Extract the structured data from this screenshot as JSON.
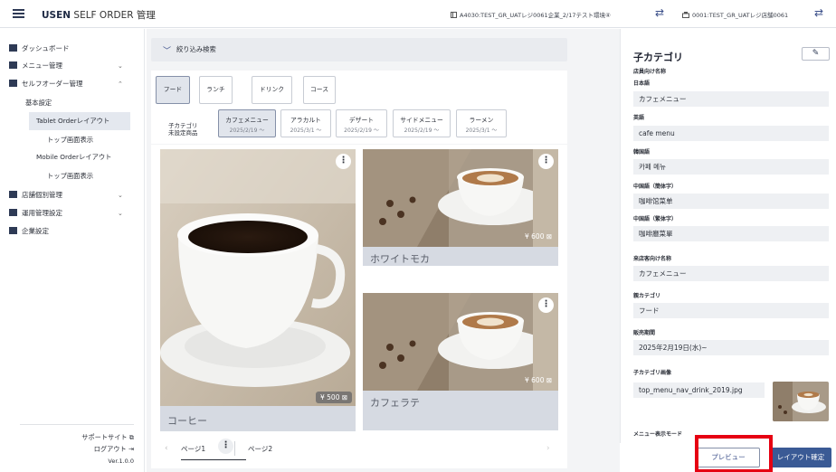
{
  "header": {
    "menu_icon": "hamburger-icon",
    "app_brand": "USEN",
    "app_title": "SELF ORDER 管理",
    "store_info": "A4030:TEST_GR_UATレジ0061企業_2/17テスト環境④",
    "register_info": "0001:TEST_GR_UATレジ店舗0061",
    "swap_icon": "swap-arrows-icon"
  },
  "sidebar": {
    "items": [
      {
        "label": "ダッシュボード",
        "icon": "dashboard-icon"
      },
      {
        "label": "メニュー管理",
        "icon": "book-icon",
        "chevron": "⌄"
      },
      {
        "label": "セルフオーダー管理",
        "icon": "tablet-icon",
        "chevron": "⌃"
      },
      {
        "label": "店舗個別管理",
        "icon": "store-icon",
        "chevron": "⌄"
      },
      {
        "label": "運用管理設定",
        "icon": "folder-icon",
        "chevron": "⌄"
      },
      {
        "label": "企業設定",
        "icon": "building-icon"
      }
    ],
    "subitems": [
      "基本設定",
      "Tablet Orderレイアウト",
      "トップ画面表示",
      "Mobile Orderレイアウト",
      "トップ画面表示"
    ],
    "footer": {
      "support": "サポートサイト",
      "logout": "ログアウト",
      "version": "Ver.1.0.0"
    }
  },
  "main": {
    "filter_label": "絞り込み検索",
    "tabs": [
      "フード",
      "ランチ",
      "ドリンク",
      "コース"
    ],
    "unset_label_1": "子カテゴリ",
    "unset_label_2": "未設定商品",
    "subcategories": [
      {
        "name": "カフェメニュー",
        "date": "2025/2/19 ～"
      },
      {
        "name": "アラカルト",
        "date": "2025/3/1 ～"
      },
      {
        "name": "デザート",
        "date": "2025/2/19 ～"
      },
      {
        "name": "サイドメニュー",
        "date": "2025/2/19 ～"
      },
      {
        "name": "ラーメン",
        "date": "2025/3/1 ～"
      }
    ],
    "cards": [
      {
        "name": "コーヒー",
        "price": "¥ 500 ⊠"
      },
      {
        "name": "ホワイトモカ",
        "price": "¥ 600 ⊠"
      },
      {
        "name": "カフェラテ",
        "price": "¥ 600 ⊠"
      }
    ],
    "pages": [
      "ページ1",
      "ページ2"
    ]
  },
  "detail": {
    "title": "子カテゴリ",
    "staff_name_label": "店員向け名称",
    "fields": [
      {
        "label": "日本語",
        "value": "カフェメニュー"
      },
      {
        "label": "英語",
        "value": "cafe menu"
      },
      {
        "label": "韓国語",
        "value": "카페 메뉴"
      },
      {
        "label": "中国語（簡体字）",
        "value": "咖啡馆菜单"
      },
      {
        "label": "中国語（繁体字）",
        "value": "咖啡廳菜單"
      },
      {
        "label": "来店客向け名称",
        "value": "カフェメニュー"
      },
      {
        "label": "親カテゴリ",
        "value": "フード"
      },
      {
        "label": "販売期間",
        "value": "2025年2月19日(水)~"
      }
    ],
    "image_label": "子カテゴリ画像",
    "image_file": "top_menu_nav_drink_2019.jpg",
    "display_mode_label": "メニュー表示モード"
  },
  "buttons": {
    "preview": "プレビュー",
    "confirm": "レイアウト確定"
  },
  "colors": {
    "accent": "#3a5a95",
    "highlight": "#e60012",
    "panel_bg": "#f3f4f6"
  }
}
